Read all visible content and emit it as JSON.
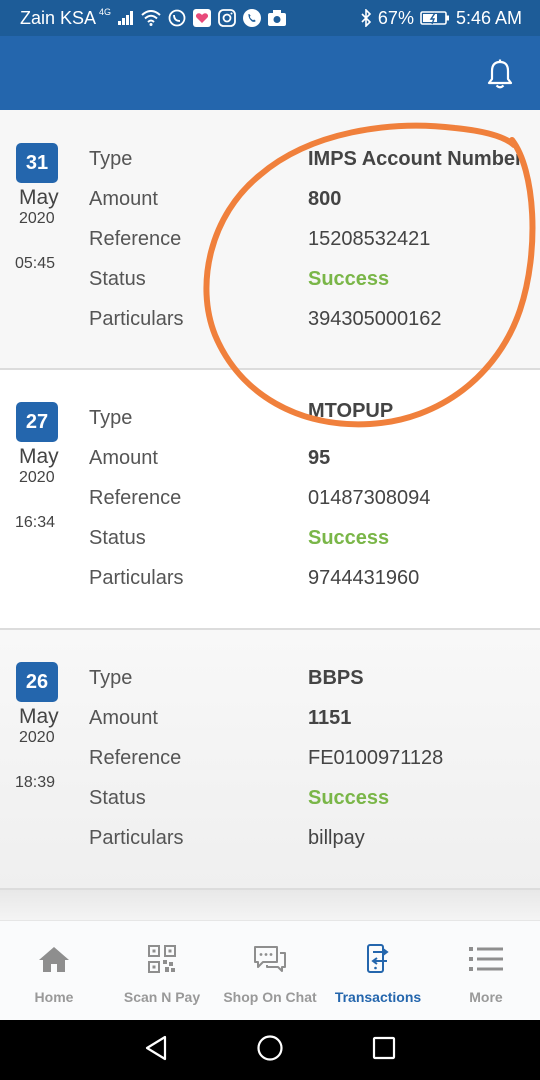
{
  "statusbar": {
    "carrier": "Zain KSA",
    "network": "4G",
    "battery": "67%",
    "time": "5:46 AM",
    "icons": [
      "signal-icon",
      "wifi-icon",
      "whatsapp-icon",
      "heart-app-icon",
      "instagram-icon",
      "phone-icon",
      "camera-icon",
      "bluetooth-icon",
      "battery-icon"
    ]
  },
  "appbar": {
    "icon": "bell-icon"
  },
  "labels": {
    "type": "Type",
    "amount": "Amount",
    "reference": "Reference",
    "status": "Status",
    "particulars": "Particulars"
  },
  "transactions": [
    {
      "day": "31",
      "month": "May",
      "year": "2020",
      "time": "05:45",
      "type": "IMPS Account Number",
      "amount": "800",
      "reference": "15208532421",
      "status": "Success",
      "particulars": "394305000162"
    },
    {
      "day": "27",
      "month": "May",
      "year": "2020",
      "time": "16:34",
      "type": "MTOPUP",
      "amount": "95",
      "reference": "01487308094",
      "status": "Success",
      "particulars": "9744431960"
    },
    {
      "day": "26",
      "month": "May",
      "year": "2020",
      "time": "18:39",
      "type": "BBPS",
      "amount": "1151",
      "reference": "FE0100971128",
      "status": "Success",
      "particulars": "billpay"
    }
  ],
  "bottom_nav": [
    {
      "label": "Home",
      "icon": "home-icon",
      "active": false
    },
    {
      "label": "Scan N Pay",
      "icon": "qr-code-icon",
      "active": false
    },
    {
      "label": "Shop On Chat",
      "icon": "chat-icon",
      "active": false
    },
    {
      "label": "Transactions",
      "icon": "transactions-icon",
      "active": true
    },
    {
      "label": "More",
      "icon": "menu-list-icon",
      "active": false
    }
  ],
  "colors": {
    "primary": "#2466ad",
    "statusbar": "#1d5c98",
    "success": "#7ab648",
    "annotation": "#f0803c"
  }
}
